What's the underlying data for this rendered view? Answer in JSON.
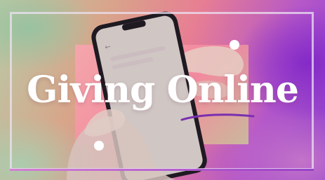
{
  "banner": {
    "title": "Giving Online"
  },
  "colors": {
    "frame": "#ebe1f0",
    "swoosh": "#7a2fb0",
    "accent_pink": "#e77e93",
    "accent_purple": "#8e3fce",
    "accent_green": "#b9c9a6"
  },
  "icons": {
    "phone_back_glyph": "←"
  }
}
